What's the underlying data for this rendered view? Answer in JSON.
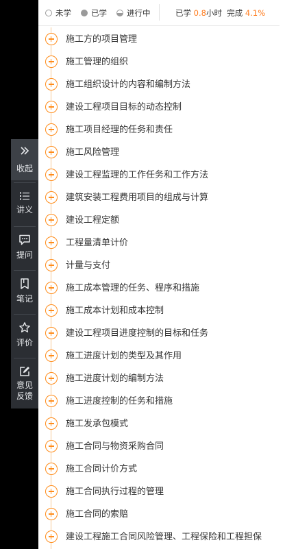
{
  "legend": {
    "unlearned": "未学",
    "learned": "已学",
    "in_progress": "进行中",
    "stats_learned_prefix": "已学",
    "stats_hours_value": "0.8",
    "stats_hours_unit": "小时",
    "stats_complete_label": "完成",
    "stats_complete_value": "4.1%"
  },
  "colors": {
    "accent": "#ff7a1a",
    "panel": "#2b2e33",
    "tree_line": "#f6c795"
  },
  "side_menu": [
    {
      "label": "收起",
      "icon": "collapse-icon"
    },
    {
      "label": "讲义",
      "icon": "list-icon"
    },
    {
      "label": "提问",
      "icon": "chat-icon"
    },
    {
      "label": "笔记",
      "icon": "note-icon"
    },
    {
      "label": "评价",
      "icon": "star-icon"
    },
    {
      "label": "意见",
      "label2": "反馈",
      "icon": "edit-icon"
    }
  ],
  "lessons": [
    "施工方的项目管理",
    "施工管理的组织",
    "施工组织设计的内容和编制方法",
    "建设工程项目目标的动态控制",
    "施工项目经理的任务和责任",
    "施工风险管理",
    "建设工程监理的工作任务和工作方法",
    "建筑安装工程费用项目的组成与计算",
    "建设工程定额",
    "工程量清单计价",
    "计量与支付",
    "施工成本管理的任务、程序和措施",
    "施工成本计划和成本控制",
    "建设工程项目进度控制的目标和任务",
    "施工进度计划的类型及其作用",
    "施工进度计划的编制方法",
    "施工进度控制的任务和措施",
    "施工发承包模式",
    "施工合同与物资采购合同",
    "施工合同计价方式",
    "施工合同执行过程的管理",
    "施工合同的索赔",
    "建设工程施工合同风险管理、工程保险和工程担保"
  ]
}
